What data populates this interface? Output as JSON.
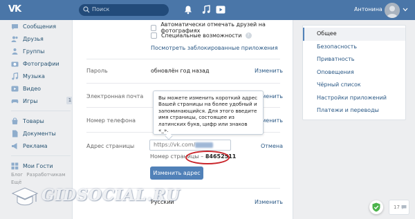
{
  "header": {
    "logo": "VK",
    "search_placeholder": "Поиск",
    "user_name": "Антонина"
  },
  "sidebar": {
    "items": [
      {
        "label": "Сообщения",
        "icon": "message-icon"
      },
      {
        "label": "Друзья",
        "icon": "friends-icon"
      },
      {
        "label": "Группы",
        "icon": "groups-icon"
      },
      {
        "label": "Фотографии",
        "icon": "photo-icon"
      },
      {
        "label": "Музыка",
        "icon": "music-icon"
      },
      {
        "label": "Видео",
        "icon": "video-icon"
      },
      {
        "label": "Игры",
        "icon": "games-icon",
        "badge": "1"
      }
    ],
    "items2": [
      {
        "label": "Товары",
        "icon": "goods-icon"
      },
      {
        "label": "Документы",
        "icon": "documents-icon"
      },
      {
        "label": "Реклама",
        "icon": "ads-icon"
      }
    ],
    "items3": [
      {
        "label": "Мои Гости",
        "icon": "guests-icon"
      }
    ],
    "footer": [
      "Блог",
      "Разработчикам",
      "Ещё"
    ]
  },
  "settings": {
    "checkbox_photos": "Автоматически отмечать друзей на фотографиях",
    "checkbox_accessibility": "Специальные возможности",
    "blocked_apps_link": "Посмотреть заблокированные приложения",
    "password": {
      "label": "Пароль",
      "value": "обновлён год назад",
      "action": "Изменить"
    },
    "email": {
      "label": "Электронная почта",
      "action": "Изменить"
    },
    "phone": {
      "label": "Номер телефона",
      "action": "Изменить"
    },
    "address": {
      "label": "Адрес страницы",
      "input_value": "https://vk.com/",
      "cancel": "Отмена",
      "page_number_label": "Номер страницы –",
      "page_number": "84652511",
      "button": "Изменить адрес"
    },
    "language": {
      "value": "Русский",
      "action": "Изменить"
    },
    "tooltip": "Вы можете изменить короткий адрес Вашей страницы на более удобный и запоминающийся. Для этого введите имя страницы, состоящее из латинских букв, цифр или знаков «_»."
  },
  "right_menu": {
    "items": [
      "Общее",
      "Безопасность",
      "Приватность",
      "Оповещения",
      "Чёрный список",
      "Настройки приложений",
      "Платежи и переводы"
    ],
    "active_index": 0
  },
  "watermark": "GIDSOCIAL.RU",
  "chat": {
    "count": "17"
  },
  "colors": {
    "brand": "#4a76a8",
    "link": "#2a5885",
    "button": "#5181b8",
    "highlight": "#c9242a"
  }
}
